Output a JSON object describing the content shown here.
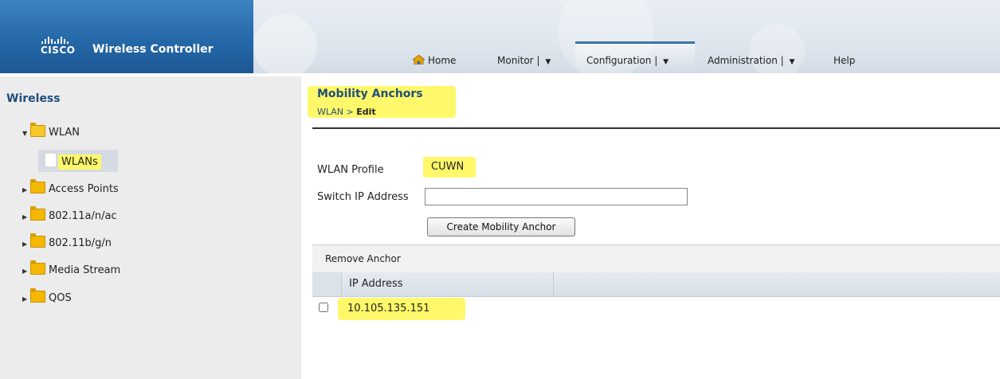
{
  "header": {
    "logo_text": "CISCO",
    "product_name": "Wireless Controller",
    "nav": {
      "home": "Home",
      "monitor": "Monitor",
      "configuration": "Configuration",
      "administration": "Administration",
      "help": "Help",
      "dropdown_separator": "|",
      "dropdown_caret": "▼"
    }
  },
  "sidebar": {
    "title": "Wireless",
    "items": [
      {
        "label": "WLAN",
        "icon": "folder-open-icon",
        "expanded": true
      },
      {
        "label": "WLANs",
        "icon": "page-icon",
        "selected": true
      },
      {
        "label": "Access Points",
        "icon": "folder-icon"
      },
      {
        "label": "802.11a/n/ac",
        "icon": "folder-icon"
      },
      {
        "label": "802.11b/g/n",
        "icon": "folder-icon"
      },
      {
        "label": "Media Stream",
        "icon": "folder-icon"
      },
      {
        "label": "QOS",
        "icon": "folder-icon"
      }
    ],
    "expand_glyph": "▶",
    "collapse_glyph": "▼"
  },
  "main": {
    "title": "Mobility Anchors",
    "breadcrumb_parent": "WLAN",
    "breadcrumb_sep": " > ",
    "breadcrumb_current": "Edit",
    "wlan_profile_label": "WLAN Profile",
    "wlan_profile_value": "CUWN",
    "switch_ip_label": "Switch IP Address",
    "switch_ip_value": "",
    "create_button": "Create Mobility Anchor",
    "remove_anchor": "Remove Anchor",
    "table": {
      "columns": [
        "IP Address"
      ],
      "rows": [
        {
          "ip": "10.105.135.151",
          "checked": false
        }
      ]
    }
  },
  "colors": {
    "brand_blue": "#2568a8",
    "title_blue": "#1f4f7c",
    "highlight_yellow": "#fff86a",
    "folder_yellow": "#f5b800"
  }
}
